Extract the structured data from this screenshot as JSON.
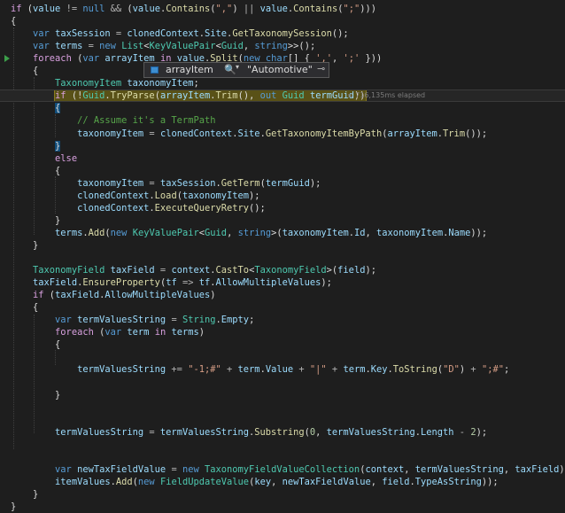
{
  "lines": [
    [
      [
        "ctl",
        "if"
      ],
      [
        "txt",
        " ("
      ],
      [
        "var",
        "value"
      ],
      [
        "op",
        " != "
      ],
      [
        "kw",
        "null"
      ],
      [
        "op",
        " && "
      ],
      [
        "txt",
        "("
      ],
      [
        "var",
        "value"
      ],
      [
        "txt",
        "."
      ],
      [
        "fn",
        "Contains"
      ],
      [
        "txt",
        "("
      ],
      [
        "str",
        "\",\""
      ],
      [
        "txt",
        ") "
      ],
      [
        "op",
        "||"
      ],
      [
        "txt",
        " "
      ],
      [
        "var",
        "value"
      ],
      [
        "txt",
        "."
      ],
      [
        "fn",
        "Contains"
      ],
      [
        "txt",
        "("
      ],
      [
        "str",
        "\";\""
      ],
      [
        "txt",
        "))) "
      ]
    ],
    [
      [
        "txt",
        "{"
      ]
    ],
    [
      [
        "txt",
        "    "
      ],
      [
        "kw",
        "var"
      ],
      [
        "txt",
        " "
      ],
      [
        "var",
        "taxSession"
      ],
      [
        "op",
        " = "
      ],
      [
        "var",
        "clonedContext"
      ],
      [
        "txt",
        "."
      ],
      [
        "var",
        "Site"
      ],
      [
        "txt",
        "."
      ],
      [
        "fn",
        "GetTaxonomySession"
      ],
      [
        "txt",
        "();"
      ]
    ],
    [
      [
        "txt",
        "    "
      ],
      [
        "kw",
        "var"
      ],
      [
        "txt",
        " "
      ],
      [
        "var",
        "terms"
      ],
      [
        "op",
        " = "
      ],
      [
        "kw",
        "new"
      ],
      [
        "txt",
        " "
      ],
      [
        "ty",
        "List"
      ],
      [
        "txt",
        "<"
      ],
      [
        "ty",
        "KeyValuePair"
      ],
      [
        "txt",
        "<"
      ],
      [
        "ty",
        "Guid"
      ],
      [
        "txt",
        ", "
      ],
      [
        "kw",
        "string"
      ],
      [
        "txt",
        ">>();"
      ]
    ],
    [
      [
        "txt",
        "    "
      ],
      [
        "ctl",
        "foreach"
      ],
      [
        "txt",
        " ("
      ],
      [
        "kw",
        "var"
      ],
      [
        "txt",
        " "
      ],
      [
        "var",
        "arrayItem"
      ],
      [
        "txt",
        " "
      ],
      [
        "ctl",
        "in"
      ],
      [
        "txt",
        " "
      ],
      [
        "var",
        "value"
      ],
      [
        "txt",
        "."
      ],
      [
        "fn",
        "Split"
      ],
      [
        "txt",
        "("
      ],
      [
        "kw",
        "new"
      ],
      [
        "txt",
        " "
      ],
      [
        "kw",
        "char"
      ],
      [
        "txt",
        "[] { "
      ],
      [
        "str",
        "','"
      ],
      [
        "txt",
        ", "
      ],
      [
        "str",
        "';'"
      ],
      [
        "txt",
        " }))"
      ]
    ],
    [
      [
        "txt",
        "    {"
      ]
    ],
    [
      [
        "txt",
        "        "
      ],
      [
        "ty",
        "TaxonomyItem"
      ],
      [
        "txt",
        " "
      ],
      [
        "var",
        "taxonomyItem"
      ],
      [
        "txt",
        ";"
      ]
    ],
    [
      [
        "txt",
        "        "
      ],
      [
        "ctl",
        "if"
      ],
      [
        "txt",
        " (!"
      ],
      [
        "ty",
        "Guid"
      ],
      [
        "txt",
        "."
      ],
      [
        "fn",
        "TryParse"
      ],
      [
        "txt",
        "("
      ],
      [
        "var",
        "arrayItem"
      ],
      [
        "txt",
        "."
      ],
      [
        "fn",
        "Trim"
      ],
      [
        "txt",
        "(), "
      ],
      [
        "kw",
        "out"
      ],
      [
        "txt",
        " "
      ],
      [
        "ty",
        "Guid"
      ],
      [
        "txt",
        " "
      ],
      [
        "var",
        "termGuid"
      ],
      [
        "txt",
        "))"
      ]
    ],
    [
      [
        "txt",
        "        {"
      ]
    ],
    [
      [
        "txt",
        "            "
      ],
      [
        "cm",
        "// Assume it's a TermPath"
      ]
    ],
    [
      [
        "txt",
        "            "
      ],
      [
        "var",
        "taxonomyItem"
      ],
      [
        "op",
        " = "
      ],
      [
        "var",
        "clonedContext"
      ],
      [
        "txt",
        "."
      ],
      [
        "var",
        "Site"
      ],
      [
        "txt",
        "."
      ],
      [
        "fn",
        "GetTaxonomyItemByPath"
      ],
      [
        "txt",
        "("
      ],
      [
        "var",
        "arrayItem"
      ],
      [
        "txt",
        "."
      ],
      [
        "fn",
        "Trim"
      ],
      [
        "txt",
        "());"
      ]
    ],
    [
      [
        "txt",
        "        }"
      ]
    ],
    [
      [
        "txt",
        "        "
      ],
      [
        "ctl",
        "else"
      ]
    ],
    [
      [
        "txt",
        "        {"
      ]
    ],
    [
      [
        "txt",
        "            "
      ],
      [
        "var",
        "taxonomyItem"
      ],
      [
        "op",
        " = "
      ],
      [
        "var",
        "taxSession"
      ],
      [
        "txt",
        "."
      ],
      [
        "fn",
        "GetTerm"
      ],
      [
        "txt",
        "("
      ],
      [
        "var",
        "termGuid"
      ],
      [
        "txt",
        ");"
      ]
    ],
    [
      [
        "txt",
        "            "
      ],
      [
        "var",
        "clonedContext"
      ],
      [
        "txt",
        "."
      ],
      [
        "fn",
        "Load"
      ],
      [
        "txt",
        "("
      ],
      [
        "var",
        "taxonomyItem"
      ],
      [
        "txt",
        ");"
      ]
    ],
    [
      [
        "txt",
        "            "
      ],
      [
        "var",
        "clonedContext"
      ],
      [
        "txt",
        "."
      ],
      [
        "fn",
        "ExecuteQueryRetry"
      ],
      [
        "txt",
        "();"
      ]
    ],
    [
      [
        "txt",
        "        }"
      ]
    ],
    [
      [
        "txt",
        "        "
      ],
      [
        "var",
        "terms"
      ],
      [
        "txt",
        "."
      ],
      [
        "fn",
        "Add"
      ],
      [
        "txt",
        "("
      ],
      [
        "kw",
        "new"
      ],
      [
        "txt",
        " "
      ],
      [
        "ty",
        "KeyValuePair"
      ],
      [
        "txt",
        "<"
      ],
      [
        "ty",
        "Guid"
      ],
      [
        "txt",
        ", "
      ],
      [
        "kw",
        "string"
      ],
      [
        "txt",
        ">("
      ],
      [
        "var",
        "taxonomyItem"
      ],
      [
        "txt",
        "."
      ],
      [
        "var",
        "Id"
      ],
      [
        "txt",
        ", "
      ],
      [
        "var",
        "taxonomyItem"
      ],
      [
        "txt",
        "."
      ],
      [
        "var",
        "Name"
      ],
      [
        "txt",
        "));"
      ]
    ],
    [
      [
        "txt",
        "    }"
      ]
    ],
    [
      [
        "txt",
        ""
      ]
    ],
    [
      [
        "txt",
        "    "
      ],
      [
        "ty",
        "TaxonomyField"
      ],
      [
        "txt",
        " "
      ],
      [
        "var",
        "taxField"
      ],
      [
        "op",
        " = "
      ],
      [
        "var",
        "context"
      ],
      [
        "txt",
        "."
      ],
      [
        "fn",
        "CastTo"
      ],
      [
        "txt",
        "<"
      ],
      [
        "ty",
        "TaxonomyField"
      ],
      [
        "txt",
        ">("
      ],
      [
        "var",
        "field"
      ],
      [
        "txt",
        ");"
      ]
    ],
    [
      [
        "txt",
        "    "
      ],
      [
        "var",
        "taxField"
      ],
      [
        "txt",
        "."
      ],
      [
        "fn",
        "EnsureProperty"
      ],
      [
        "txt",
        "("
      ],
      [
        "var",
        "tf"
      ],
      [
        "op",
        " => "
      ],
      [
        "var",
        "tf"
      ],
      [
        "txt",
        "."
      ],
      [
        "var",
        "AllowMultipleValues"
      ],
      [
        "txt",
        ");"
      ]
    ],
    [
      [
        "txt",
        "    "
      ],
      [
        "ctl",
        "if"
      ],
      [
        "txt",
        " ("
      ],
      [
        "var",
        "taxField"
      ],
      [
        "txt",
        "."
      ],
      [
        "var",
        "AllowMultipleValues"
      ],
      [
        "txt",
        ")"
      ]
    ],
    [
      [
        "txt",
        "    {"
      ]
    ],
    [
      [
        "txt",
        "        "
      ],
      [
        "kw",
        "var"
      ],
      [
        "txt",
        " "
      ],
      [
        "var",
        "termValuesString"
      ],
      [
        "op",
        " = "
      ],
      [
        "ty",
        "String"
      ],
      [
        "txt",
        "."
      ],
      [
        "var",
        "Empty"
      ],
      [
        "txt",
        ";"
      ]
    ],
    [
      [
        "txt",
        "        "
      ],
      [
        "ctl",
        "foreach"
      ],
      [
        "txt",
        " ("
      ],
      [
        "kw",
        "var"
      ],
      [
        "txt",
        " "
      ],
      [
        "var",
        "term"
      ],
      [
        "txt",
        " "
      ],
      [
        "ctl",
        "in"
      ],
      [
        "txt",
        " "
      ],
      [
        "var",
        "terms"
      ],
      [
        "txt",
        ")"
      ]
    ],
    [
      [
        "txt",
        "        {"
      ]
    ],
    [
      [
        "txt",
        ""
      ]
    ],
    [
      [
        "txt",
        "            "
      ],
      [
        "var",
        "termValuesString"
      ],
      [
        "op",
        " += "
      ],
      [
        "str",
        "\"-1;#\""
      ],
      [
        "op",
        " + "
      ],
      [
        "var",
        "term"
      ],
      [
        "txt",
        "."
      ],
      [
        "var",
        "Value"
      ],
      [
        "op",
        " + "
      ],
      [
        "str",
        "\"|\""
      ],
      [
        "op",
        " + "
      ],
      [
        "var",
        "term"
      ],
      [
        "txt",
        "."
      ],
      [
        "var",
        "Key"
      ],
      [
        "txt",
        "."
      ],
      [
        "fn",
        "ToString"
      ],
      [
        "txt",
        "("
      ],
      [
        "str",
        "\"D\""
      ],
      [
        "txt",
        ") "
      ],
      [
        "op",
        "+"
      ],
      [
        "txt",
        " "
      ],
      [
        "str",
        "\";#\""
      ],
      [
        "txt",
        ";"
      ]
    ],
    [
      [
        "txt",
        ""
      ]
    ],
    [
      [
        "txt",
        "        }"
      ]
    ],
    [
      [
        "txt",
        ""
      ]
    ],
    [
      [
        "txt",
        ""
      ]
    ],
    [
      [
        "txt",
        "        "
      ],
      [
        "var",
        "termValuesString"
      ],
      [
        "op",
        " = "
      ],
      [
        "var",
        "termValuesString"
      ],
      [
        "txt",
        "."
      ],
      [
        "fn",
        "Substring"
      ],
      [
        "txt",
        "("
      ],
      [
        "num",
        "0"
      ],
      [
        "txt",
        ", "
      ],
      [
        "var",
        "termValuesString"
      ],
      [
        "txt",
        "."
      ],
      [
        "var",
        "Length"
      ],
      [
        "op",
        " - "
      ],
      [
        "num",
        "2"
      ],
      [
        "txt",
        ");"
      ]
    ],
    [
      [
        "txt",
        ""
      ]
    ],
    [
      [
        "txt",
        ""
      ]
    ],
    [
      [
        "txt",
        "        "
      ],
      [
        "kw",
        "var"
      ],
      [
        "txt",
        " "
      ],
      [
        "var",
        "newTaxFieldValue"
      ],
      [
        "op",
        " = "
      ],
      [
        "kw",
        "new"
      ],
      [
        "txt",
        " "
      ],
      [
        "ty",
        "TaxonomyFieldValueCollection"
      ],
      [
        "txt",
        "("
      ],
      [
        "var",
        "context"
      ],
      [
        "txt",
        ", "
      ],
      [
        "var",
        "termValuesString"
      ],
      [
        "txt",
        ", "
      ],
      [
        "var",
        "taxField"
      ],
      [
        "txt",
        ");"
      ]
    ],
    [
      [
        "txt",
        "        "
      ],
      [
        "var",
        "itemValues"
      ],
      [
        "txt",
        "."
      ],
      [
        "fn",
        "Add"
      ],
      [
        "txt",
        "("
      ],
      [
        "kw",
        "new"
      ],
      [
        "txt",
        " "
      ],
      [
        "ty",
        "FieldUpdateValue"
      ],
      [
        "txt",
        "("
      ],
      [
        "var",
        "key"
      ],
      [
        "txt",
        ", "
      ],
      [
        "var",
        "newTaxFieldValue"
      ],
      [
        "txt",
        ", "
      ],
      [
        "var",
        "field"
      ],
      [
        "txt",
        "."
      ],
      [
        "var",
        "TypeAsString"
      ],
      [
        "txt",
        "));"
      ]
    ],
    [
      [
        "txt",
        "    }"
      ]
    ],
    [
      [
        "txt",
        "}"
      ]
    ]
  ],
  "elapsed": "≤ 716,135ms elapsed",
  "datatip": {
    "name": "arrayItem",
    "search_icon": "search-icon",
    "search_glyph": "🔍",
    "dropdown_glyph": "▾",
    "value": "\"Automotive\"",
    "pin_icon": "pin-icon",
    "pin_glyph": "⊸"
  },
  "colors": {
    "background": "#1e1e1e",
    "keyword": "#569cd6",
    "control": "#d8a0df",
    "type": "#4ec9b0",
    "method": "#dcdcaa",
    "variable": "#9cdcfe",
    "string": "#d69d85",
    "comment": "#57a64a"
  }
}
